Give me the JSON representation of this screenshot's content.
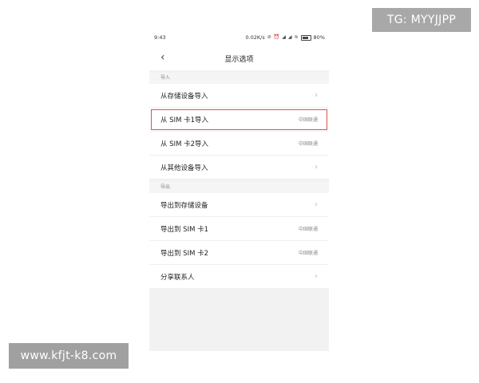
{
  "watermark": {
    "top_right": "TG: MYYJJPP",
    "bottom_left": "www.kfjt-k8.com"
  },
  "status_bar": {
    "time": "9:43",
    "net_speed": "0.02K/s",
    "battery": "80%"
  },
  "header": {
    "title": "显示选项"
  },
  "sections": [
    {
      "title": "导入",
      "items": [
        {
          "label": "从存储设备导入",
          "value": "",
          "chevron": true
        },
        {
          "label": "从 SIM 卡1导入",
          "value": "中国联通",
          "chevron": false,
          "highlighted": true
        },
        {
          "label": "从 SIM 卡2导入",
          "value": "中国联通",
          "chevron": false
        },
        {
          "label": "从其他设备导入",
          "value": "",
          "chevron": true
        }
      ]
    },
    {
      "title": "导出",
      "items": [
        {
          "label": "导出到存储设备",
          "value": "",
          "chevron": true
        },
        {
          "label": "导出到 SIM 卡1",
          "value": "中国联通",
          "chevron": false
        },
        {
          "label": "导出到 SIM 卡2",
          "value": "中国联通",
          "chevron": false
        },
        {
          "label": "分享联系人",
          "value": "",
          "chevron": true
        }
      ]
    }
  ],
  "colors": {
    "highlight": "#d9534f",
    "watermark_bg": "#a8a8a8",
    "app_bg": "#f2f2f2"
  },
  "icons": {
    "back": "chevron-left-icon",
    "chevron": "chevron-right-icon"
  }
}
